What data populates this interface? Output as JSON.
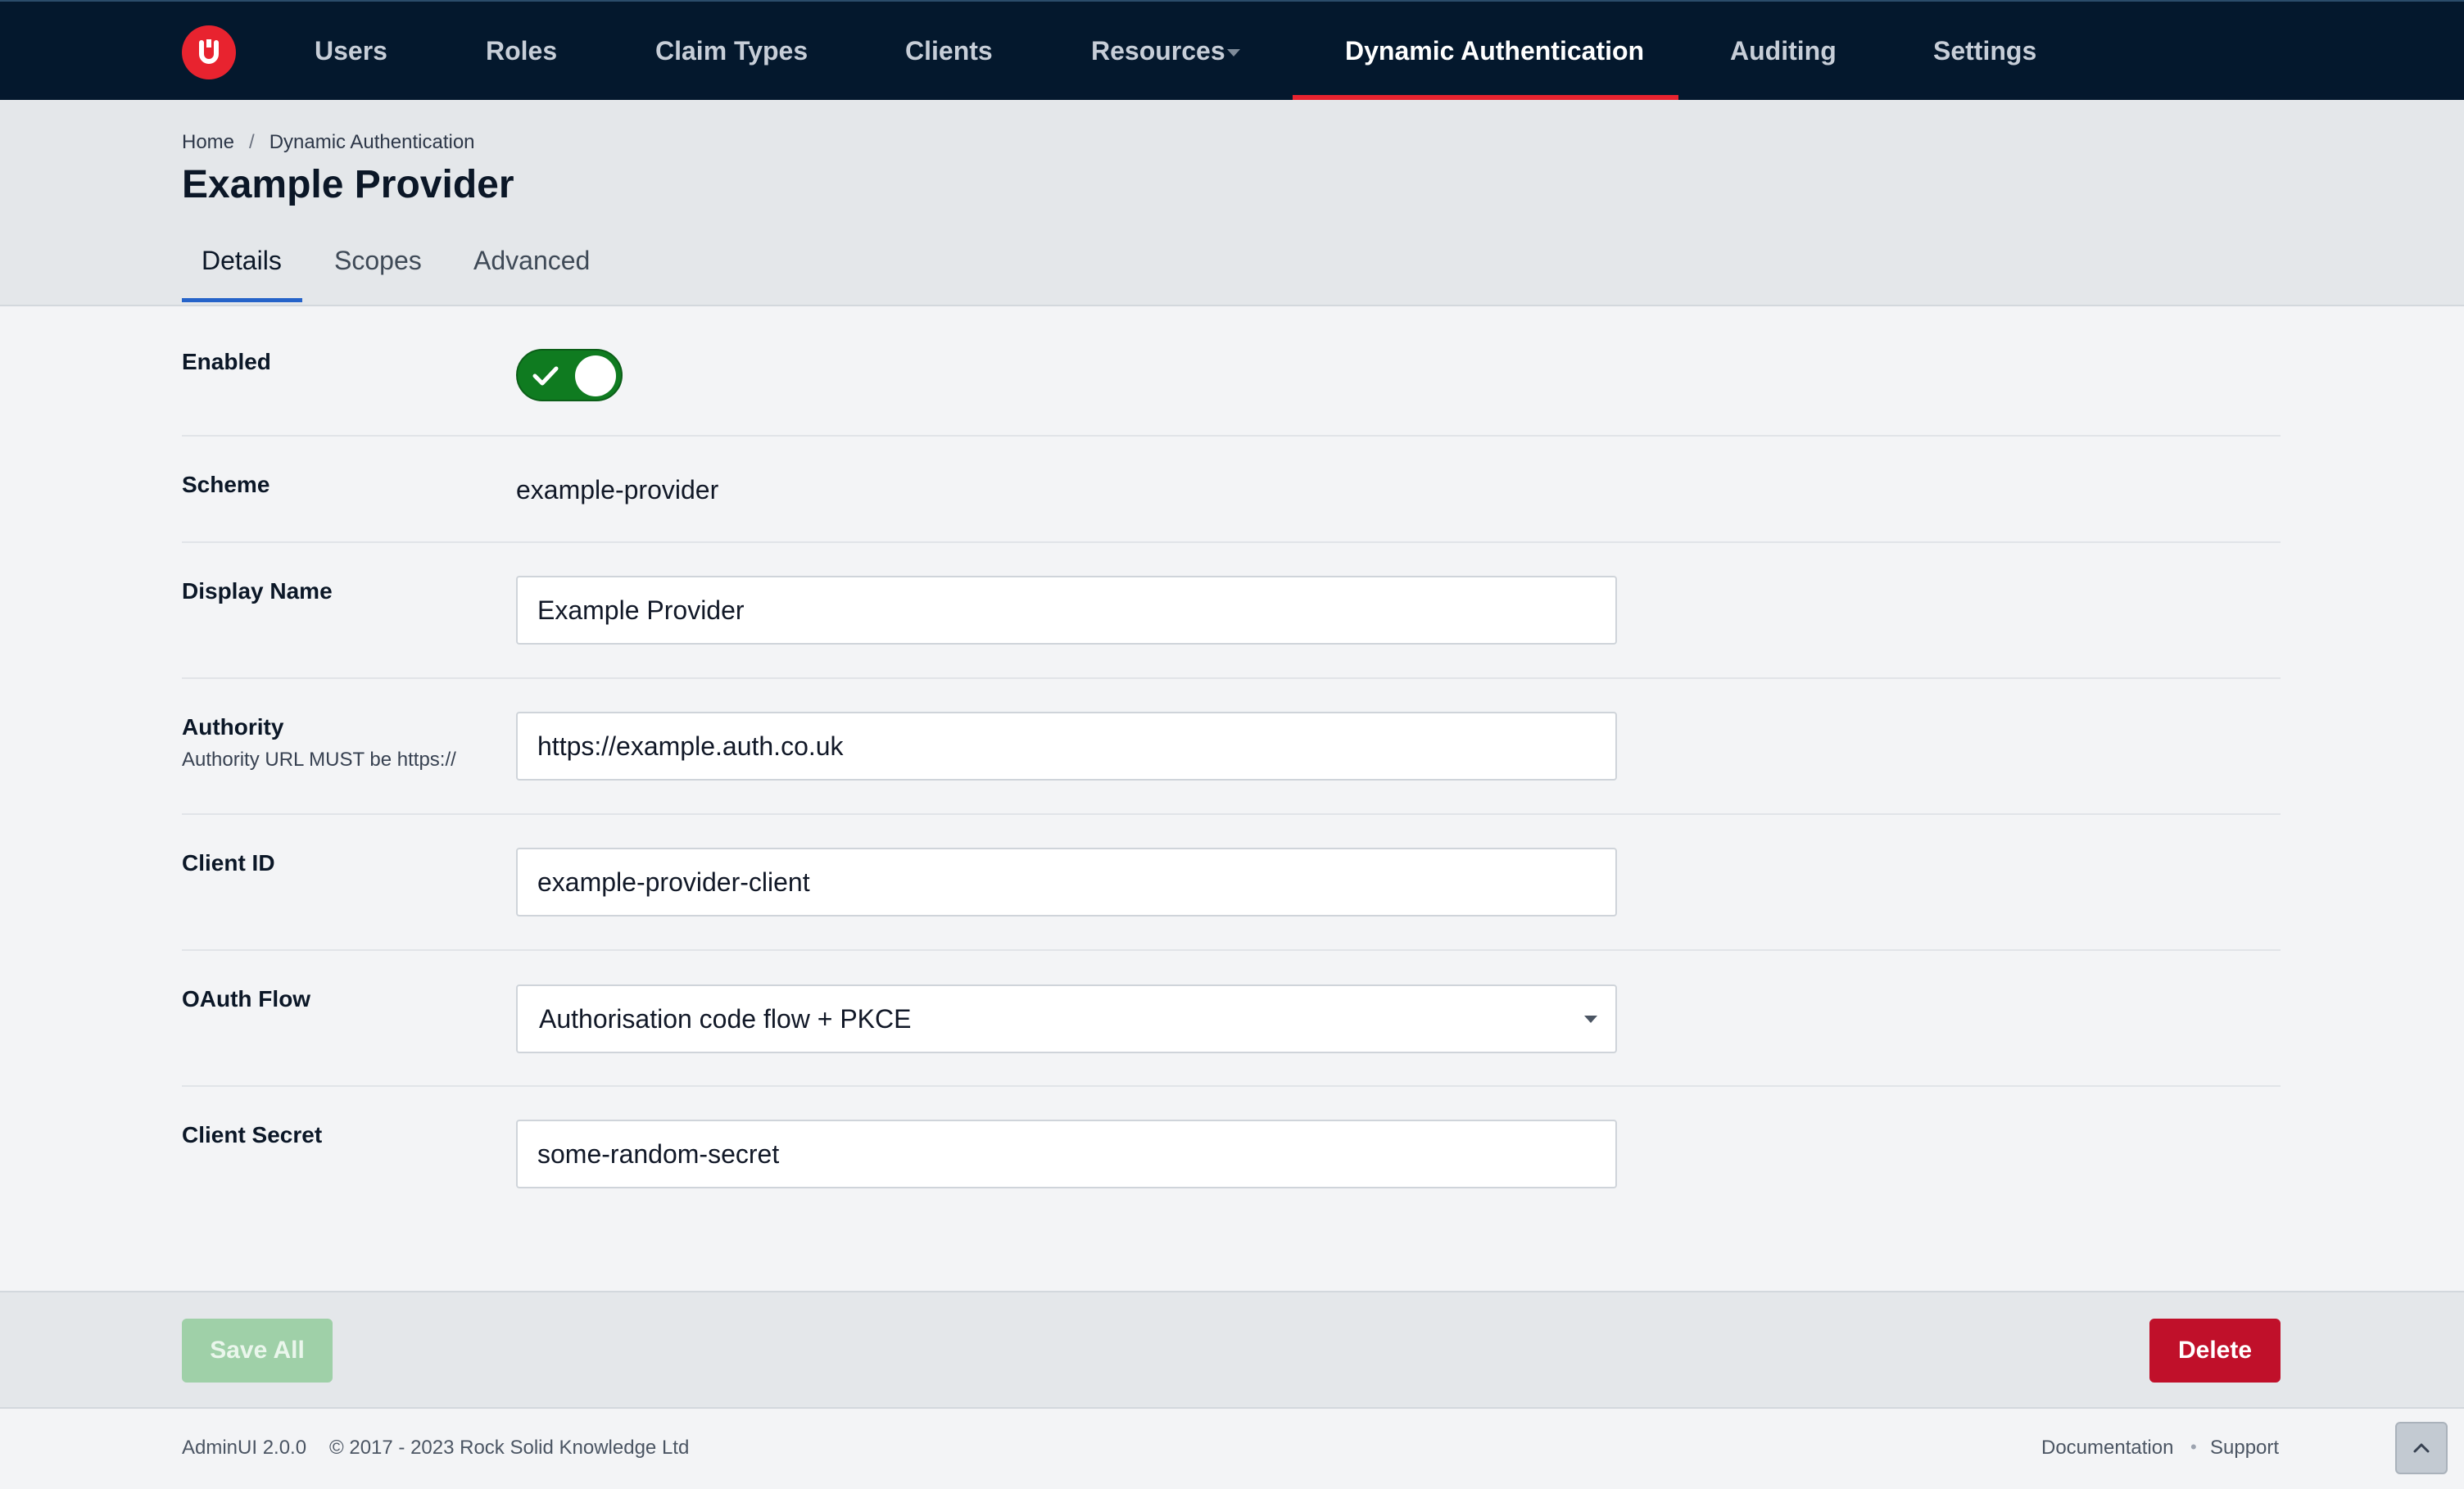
{
  "nav": {
    "logo_letter": "U",
    "items": [
      "Users",
      "Roles",
      "Claim Types",
      "Clients",
      "Resources",
      "Dynamic Authentication",
      "Auditing",
      "Settings"
    ],
    "active": "Dynamic Authentication"
  },
  "breadcrumb": {
    "home": "Home",
    "separator": "/",
    "current": "Dynamic Authentication"
  },
  "page": {
    "title": "Example Provider"
  },
  "tabs": [
    {
      "label": "Details",
      "active": true
    },
    {
      "label": "Scopes",
      "active": false
    },
    {
      "label": "Advanced",
      "active": false
    }
  ],
  "form": {
    "enabled": {
      "label": "Enabled",
      "value": true
    },
    "scheme": {
      "label": "Scheme",
      "value": "example-provider"
    },
    "display_name": {
      "label": "Display Name",
      "value": "Example Provider"
    },
    "authority": {
      "label": "Authority",
      "help": "Authority URL MUST be https://",
      "value": "https://example.auth.co.uk"
    },
    "client_id": {
      "label": "Client ID",
      "value": "example-provider-client"
    },
    "oauth_flow": {
      "label": "OAuth Flow",
      "value": "Authorisation code flow + PKCE"
    },
    "client_secret": {
      "label": "Client Secret",
      "value": "some-random-secret"
    }
  },
  "actions": {
    "save_label": "Save All",
    "delete_label": "Delete"
  },
  "footer": {
    "version": "AdminUI 2.0.0",
    "copyright": "© 2017 - 2023 Rock Solid Knowledge Ltd",
    "documentation": "Documentation",
    "support": "Support",
    "dot": "•"
  },
  "colors": {
    "nav_bg": "#04182d",
    "accent_red": "#e8232f",
    "toggle_on": "#0f7b20",
    "delete_red": "#c0102a",
    "save_disabled": "#9fd0a8",
    "tab_underline": "#2563c9"
  }
}
